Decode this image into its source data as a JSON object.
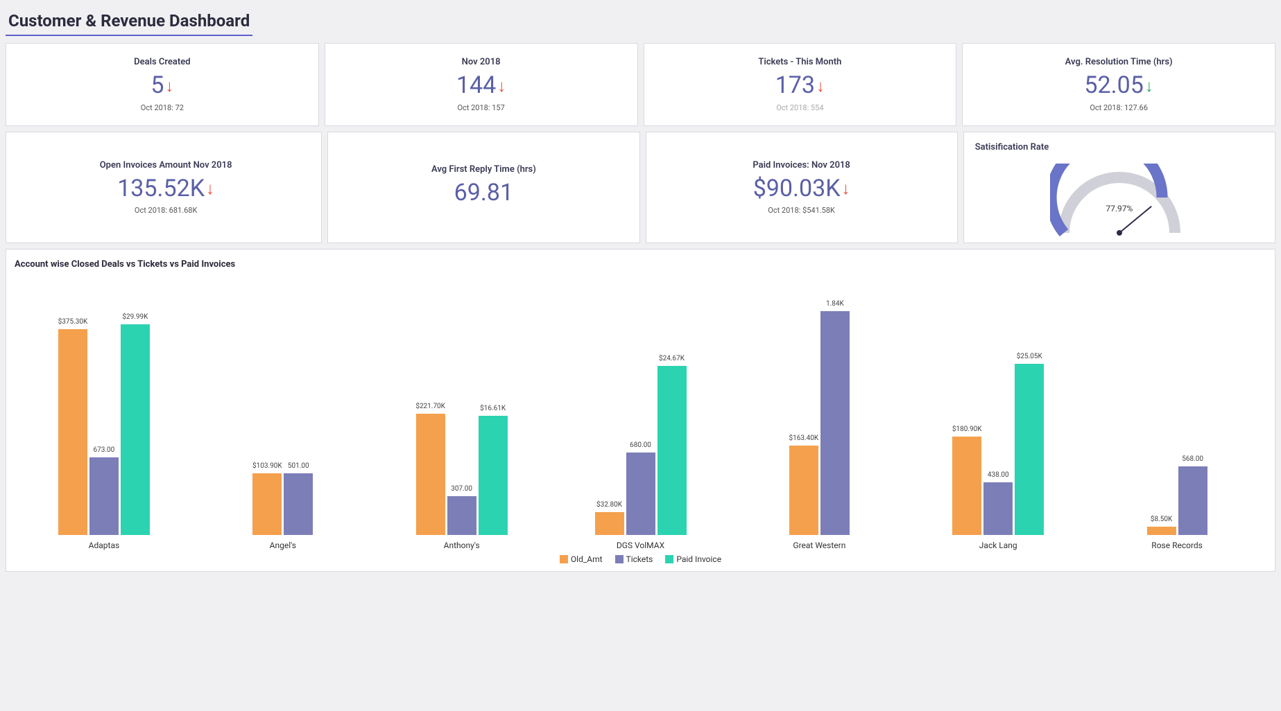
{
  "header": {
    "title": "Customer & Revenue Dashboard"
  },
  "kpis_row1": [
    {
      "title": "Deals Created",
      "value": "5",
      "arrow": "down-red",
      "sub": "Oct 2018: 72"
    },
    {
      "title": "Nov 2018",
      "value": "144",
      "arrow": "down-red",
      "sub": "Oct 2018: 157"
    },
    {
      "title": "Tickets - This Month",
      "value": "173",
      "arrow": "down-red",
      "sub": "Oct 2018: 554",
      "sub_gray": true
    },
    {
      "title": "Avg. Resolution Time (hrs)",
      "value": "52.05",
      "arrow": "down-green",
      "sub": "Oct 2018: 127.66"
    }
  ],
  "kpis_row2": [
    {
      "title": "Open Invoices Amount Nov 2018",
      "value": "135.52K",
      "arrow": "down-red",
      "sub": "Oct 2018: 681.68K"
    },
    {
      "title": "Avg First Reply Time (hrs)",
      "value": "69.81",
      "arrow": "",
      "sub": ""
    },
    {
      "title": "Paid Invoices: Nov 2018",
      "value": "$90.03K",
      "arrow": "down-red",
      "sub": "Oct 2018: $541.58K"
    }
  ],
  "gauge": {
    "title": "Satisification Rate",
    "value": 77.97,
    "label": "77.97%"
  },
  "chart_title": "Account wise Closed Deals vs Tickets vs Paid Invoices",
  "legend": {
    "orange": "Old_Amt",
    "purple": "Tickets",
    "teal": "Paid Invoice"
  },
  "colors": {
    "orange": "#f5a04d",
    "purple": "#7c7eb8",
    "teal": "#2bd3b0",
    "accent": "#5a5fc7"
  },
  "chart_data": {
    "type": "bar",
    "title": "Account wise Closed Deals vs Tickets vs Paid Invoices",
    "categories": [
      "Adaptas",
      "Angel's",
      "Anthony's",
      "DGS VolMAX",
      "Great Western",
      "Jack Lang",
      "Rose Records"
    ],
    "series": [
      {
        "name": "Old_Amt",
        "labels": [
          "$375.30K",
          "$103.90K",
          "$221.70K",
          "$32.80K",
          "$163.40K",
          "$180.90K",
          "$8.50K"
        ],
        "heights_pct": [
          90,
          27,
          53,
          10,
          39,
          43,
          3.5
        ]
      },
      {
        "name": "Tickets",
        "labels": [
          "673.00",
          "501.00",
          "307.00",
          "680.00",
          "1.84K",
          "438.00",
          "568.00"
        ],
        "heights_pct": [
          34,
          27,
          17,
          36,
          98,
          23,
          30
        ]
      },
      {
        "name": "Paid Invoice",
        "labels": [
          "$29.99K",
          "",
          "$16.61K",
          "$24.67K",
          "",
          "$25.05K",
          ""
        ],
        "heights_pct": [
          92,
          0,
          52,
          74,
          0,
          75,
          0
        ]
      }
    ],
    "legend": [
      "Old_Amt",
      "Tickets",
      "Paid Invoice"
    ]
  }
}
